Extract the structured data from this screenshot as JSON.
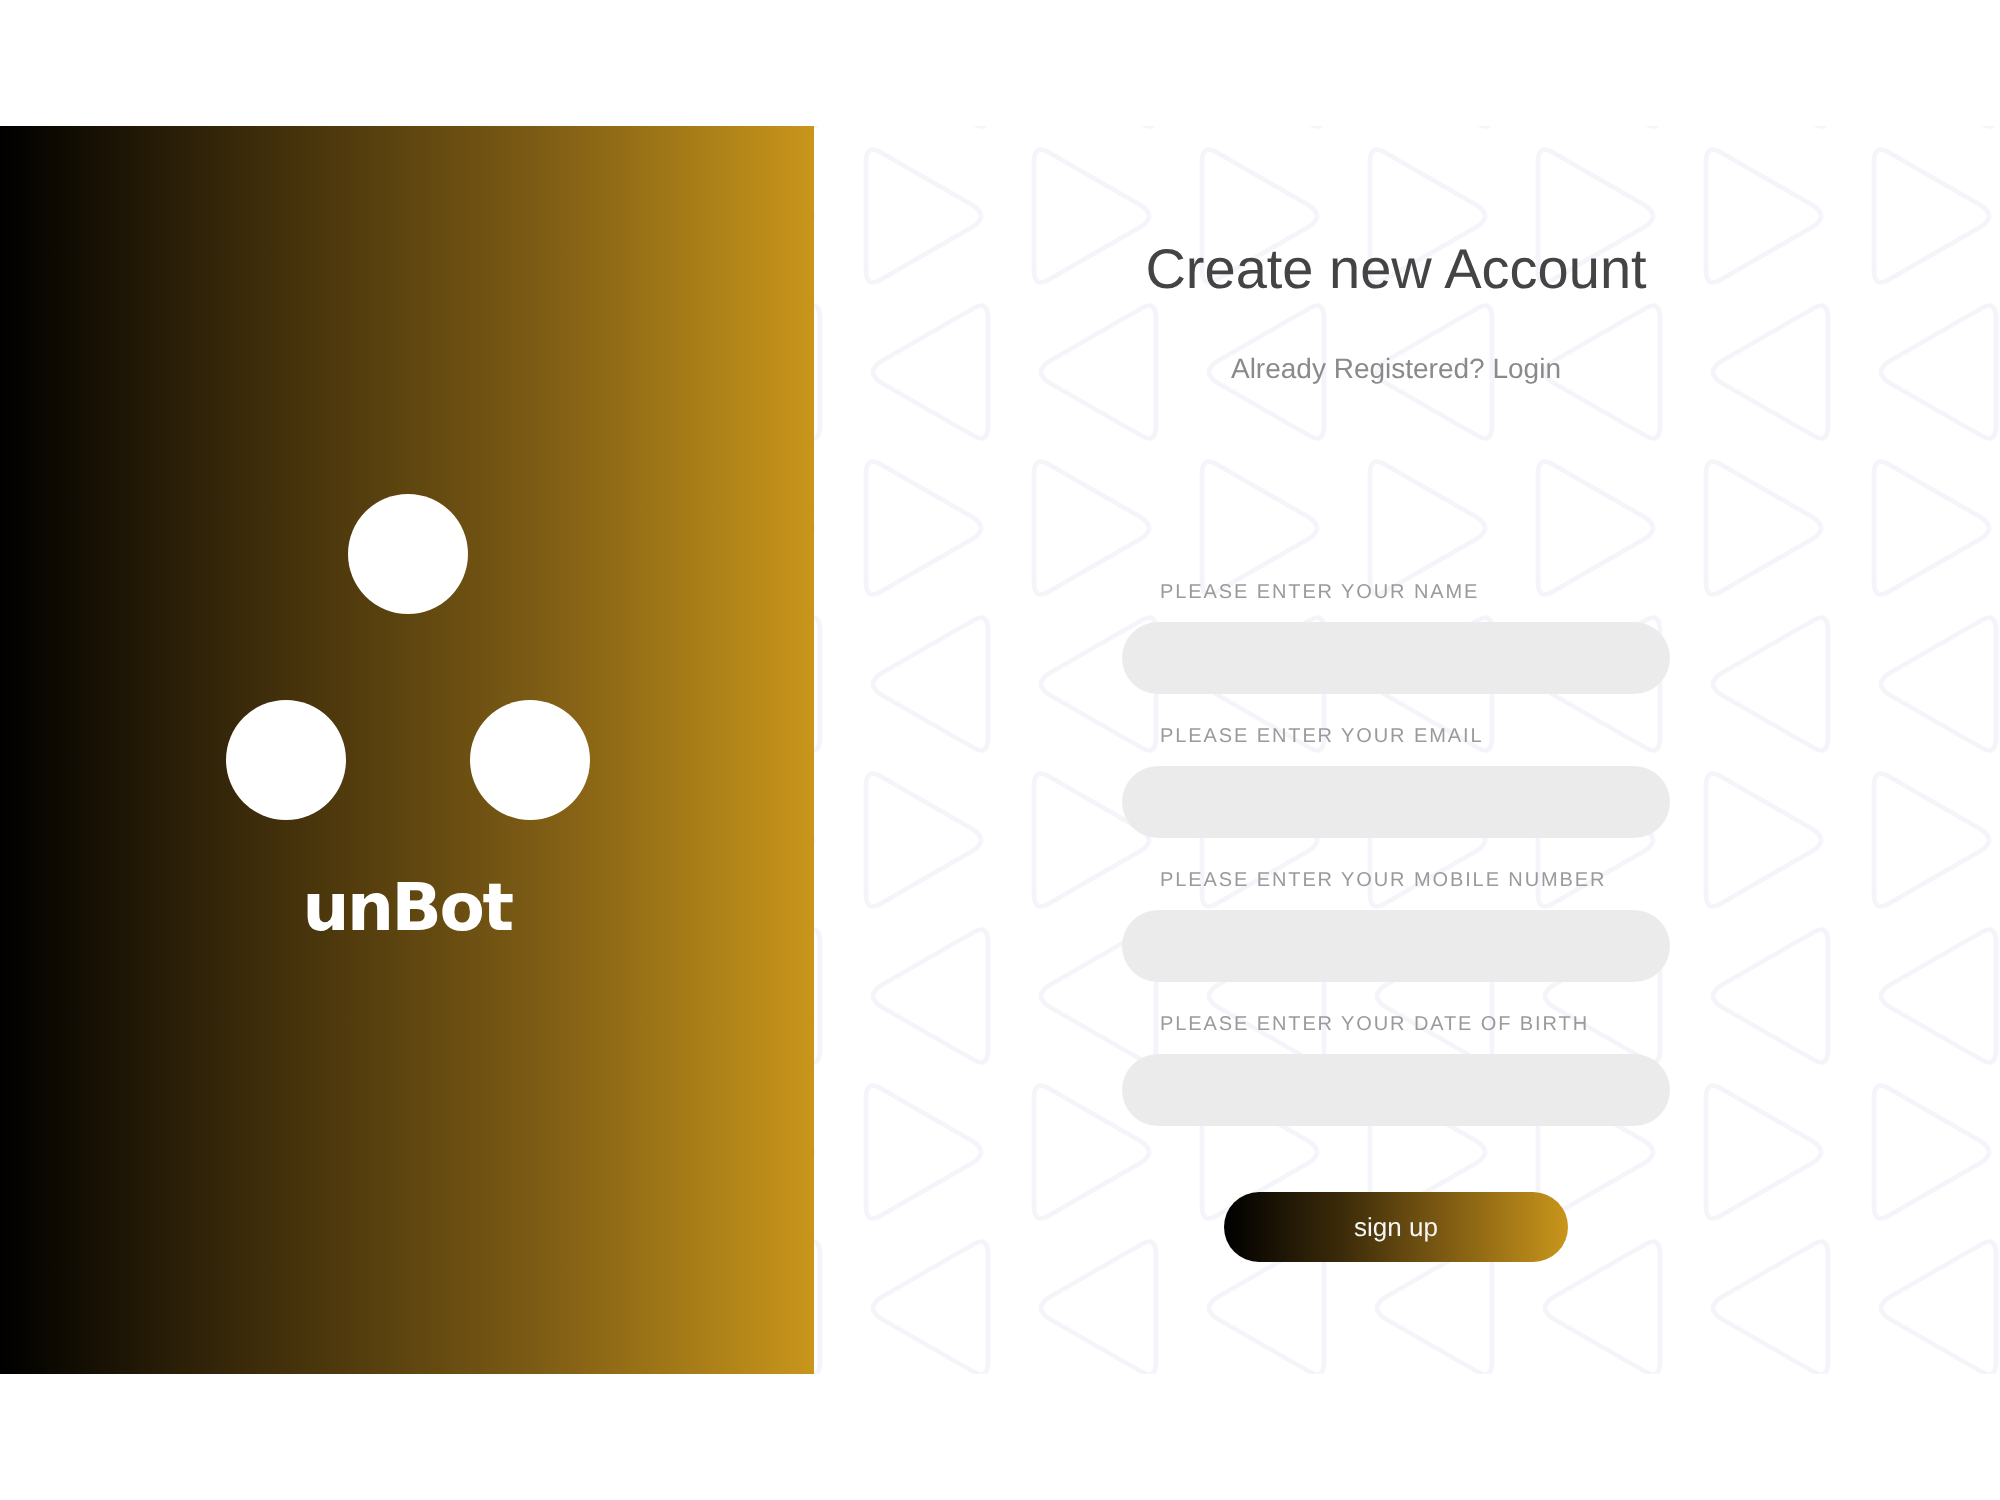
{
  "brand": {
    "wordmark": "unBot"
  },
  "form": {
    "title": "Create new Account",
    "subtitle": {
      "text": "Already Registered?",
      "link": "Login"
    },
    "fields": [
      {
        "label": "PLEASE ENTER YOUR NAME"
      },
      {
        "label": "PLEASE ENTER YOUR EMAIL"
      },
      {
        "label": "PLEASE ENTER YOUR MOBILE NUMBER"
      },
      {
        "label": "PLEASE ENTER YOUR DATE OF BIRTH"
      }
    ],
    "submit": {
      "label": "sign up"
    }
  }
}
